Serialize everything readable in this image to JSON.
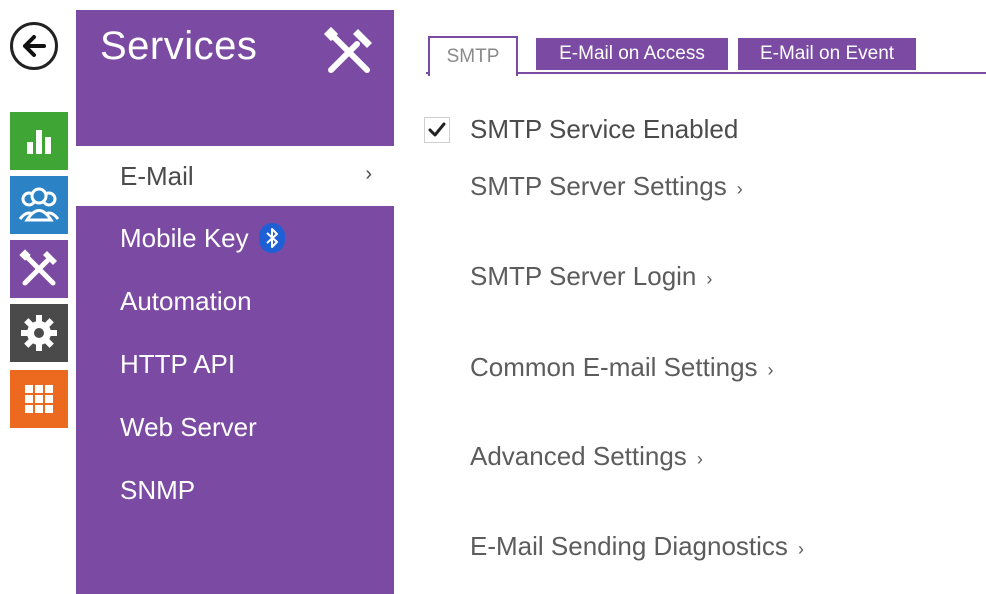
{
  "nav": {
    "back_icon": "arrow-left-icon",
    "rail": [
      {
        "name": "status",
        "icon": "bar-chart-icon",
        "color": "#3fa535"
      },
      {
        "name": "users",
        "icon": "users-icon",
        "color": "#2b82c5"
      },
      {
        "name": "services",
        "icon": "tools-icon",
        "color": "#7b4ba3"
      },
      {
        "name": "hardware",
        "icon": "gear-icon",
        "color": "#4a4a4a"
      },
      {
        "name": "system",
        "icon": "grid-icon",
        "color": "#ec6a1f"
      }
    ]
  },
  "panel": {
    "title": "Services",
    "title_icon": "tools-icon",
    "items": [
      {
        "label": "E-Mail",
        "active": true,
        "chevron": "›"
      },
      {
        "label": "Mobile Key",
        "icon": "bluetooth-icon"
      },
      {
        "label": "Automation"
      },
      {
        "label": "HTTP API"
      },
      {
        "label": "Web Server"
      },
      {
        "label": "SNMP"
      }
    ]
  },
  "tabs": [
    {
      "label": "SMTP",
      "active": true
    },
    {
      "label": "E-Mail on Access"
    },
    {
      "label": "E-Mail on Event"
    }
  ],
  "content": {
    "smtp_enabled": {
      "label": "SMTP Service Enabled",
      "checked": true
    },
    "sections": [
      {
        "label": "SMTP Server Settings",
        "arrow": "›"
      },
      {
        "label": "SMTP Server Login",
        "arrow": "›"
      },
      {
        "label": "Common E-mail Settings",
        "arrow": "›"
      },
      {
        "label": "Advanced Settings",
        "arrow": "›"
      },
      {
        "label": "E-Mail Sending Diagnostics",
        "arrow": "›"
      }
    ]
  },
  "colors": {
    "accent": "#7b4ba3",
    "status_green": "#3fa535",
    "users_blue": "#2b82c5",
    "hardware_gray": "#4a4a4a",
    "system_orange": "#ec6a1f",
    "bluetooth_blue": "#1f5fd6"
  }
}
